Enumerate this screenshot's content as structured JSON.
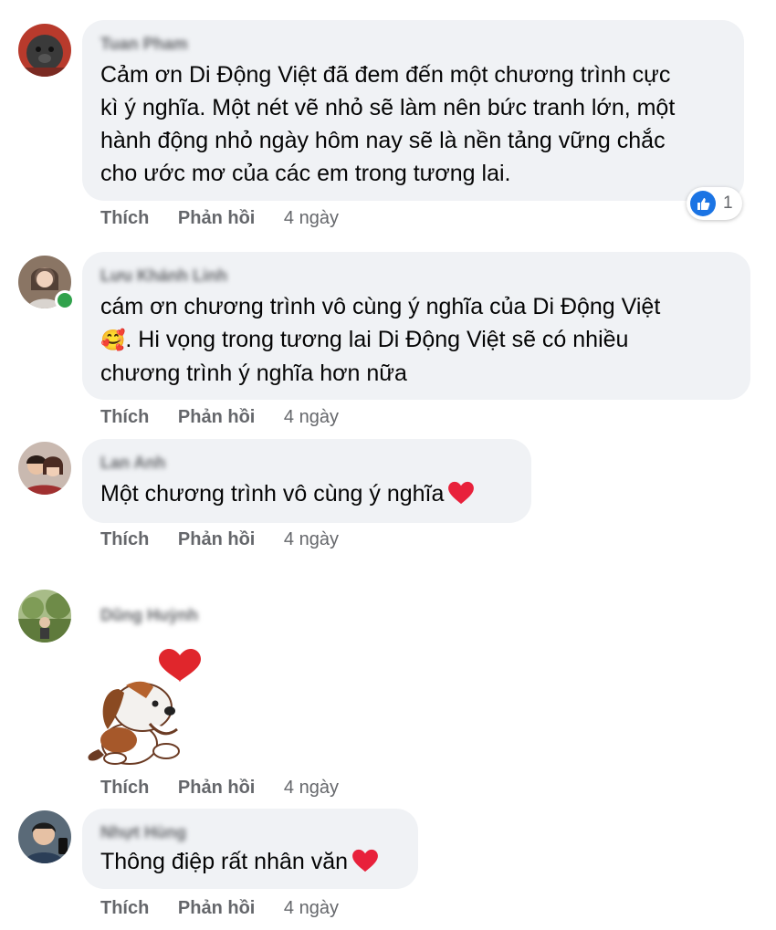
{
  "comments": [
    {
      "author": "Tuan Pham",
      "text": "Cảm ơn Di Động Việt đã đem đến một chương trình cực\nkì ý nghĩa. Một nét vẽ nhỏ sẽ làm nên bức tranh lớn, một\nhành động nhỏ ngày hôm nay sẽ là nền tảng vững chắc\ncho ước mơ của các em trong tương lai.",
      "like_label": "Thích",
      "reply_label": "Phản hồi",
      "time": "4 ngày",
      "reaction_icon": "like-icon",
      "reaction_count": "1"
    },
    {
      "author": "Lưu Khánh Linh",
      "text_line1": "cám ơn chương trình vô cùng ý nghĩa của Di Động Việt",
      "emoji": "🥰",
      "text_rest": ". Hi vọng trong tương lai Di Động Việt sẽ có nhiều\nchương trình ý nghĩa hơn nữa",
      "like_label": "Thích",
      "reply_label": "Phản hồi",
      "time": "4 ngày",
      "online": true
    },
    {
      "author": "Lan Anh",
      "text": "Một chương trình vô cùng ý nghĩa",
      "end_icon": "heart-icon",
      "like_label": "Thích",
      "reply_label": "Phản hồi",
      "time": "4 ngày"
    },
    {
      "author": "Dũng Huỳnh",
      "sticker": "puppy-heart-sticker",
      "like_label": "Thích",
      "reply_label": "Phản hồi",
      "time": "4 ngày"
    },
    {
      "author": "Nhựt Hùng",
      "text": "Thông điệp rất nhân văn",
      "end_icon": "heart-icon",
      "like_label": "Thích",
      "reply_label": "Phản hồi",
      "time": "4 ngày"
    }
  ],
  "colors": {
    "bubble": "#f0f2f5",
    "secondary_text": "#65676b",
    "like_blue": "#1b74e4",
    "heart_red": "#e8213b",
    "online_green": "#31a24c"
  }
}
